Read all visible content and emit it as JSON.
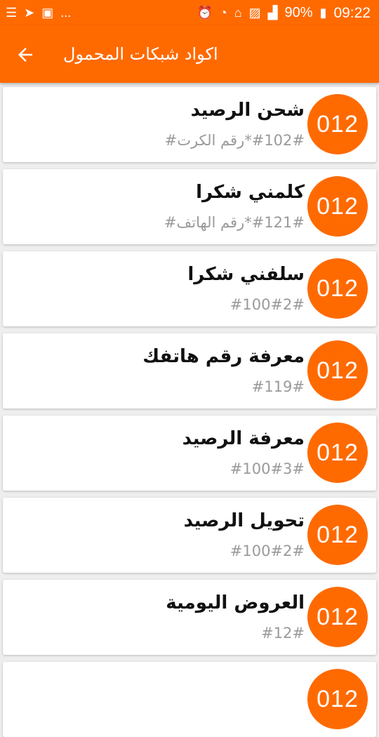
{
  "status_bar": {
    "battery": "90%",
    "time": "09:22",
    "more": "..."
  },
  "app_bar": {
    "title": "اكواد شبكات المحمول"
  },
  "items": [
    {
      "badge": "012",
      "name": "شحن الرصيد",
      "code": "#102#*رقم الكرت#"
    },
    {
      "badge": "012",
      "name": "كلمني شكرا",
      "code": "#121#*رقم الهاتف#"
    },
    {
      "badge": "012",
      "name": "سلفني شكرا",
      "code": "#100#2#"
    },
    {
      "badge": "012",
      "name": "معرفة رقم هاتفك",
      "code": "#119#"
    },
    {
      "badge": "012",
      "name": "معرفة الرصيد",
      "code": "#100#3#"
    },
    {
      "badge": "012",
      "name": "تحويل الرصيد",
      "code": "#100#2#"
    },
    {
      "badge": "012",
      "name": "العروض اليومية",
      "code": "#12#"
    },
    {
      "badge": "012",
      "name": "",
      "code": ""
    }
  ]
}
